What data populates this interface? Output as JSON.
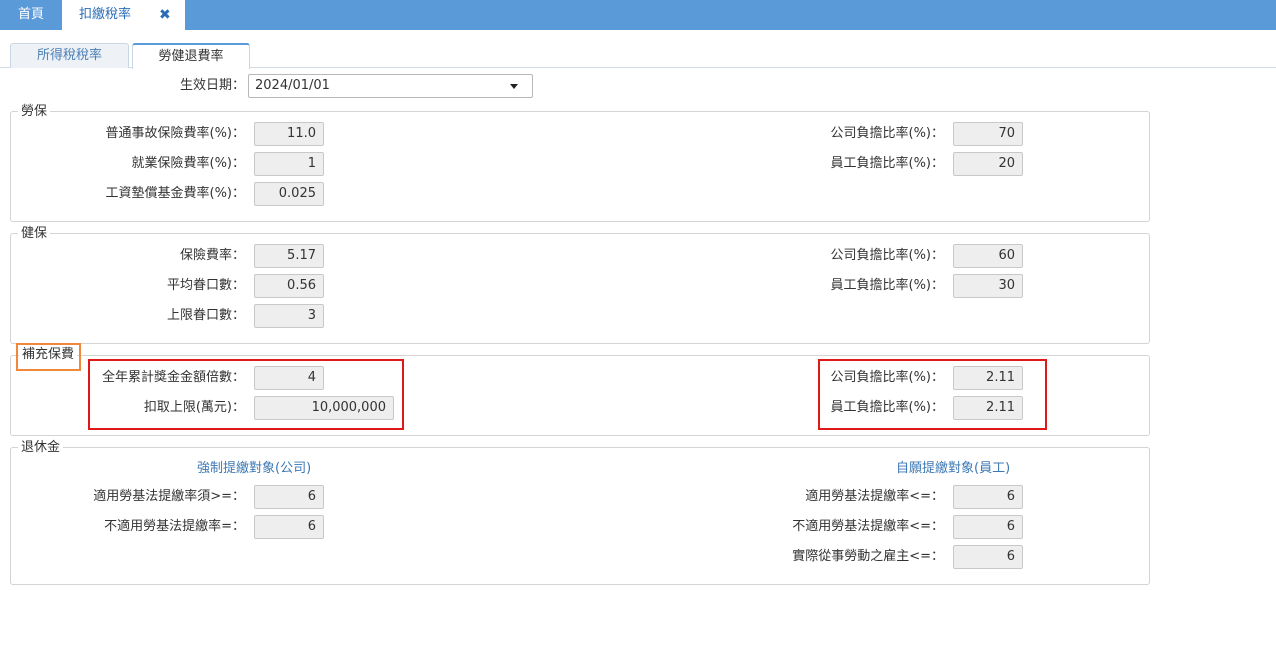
{
  "tabs": {
    "home_label": "首頁",
    "active_label": "扣繳稅率",
    "close_glyph": "✖"
  },
  "subtabs": {
    "income_tax": "所得稅稅率",
    "labor_health": "勞健退費率"
  },
  "effective_date": {
    "label": "生效日期：",
    "value": "2024/01/01"
  },
  "labor_insurance": {
    "legend": "勞保",
    "left": [
      {
        "label": "普通事故保險費率(%)：",
        "value": "11.0"
      },
      {
        "label": "就業保險費率(%)：",
        "value": "1"
      },
      {
        "label": "工資墊償基金費率(%)：",
        "value": "0.025"
      }
    ],
    "right": [
      {
        "label": "公司負擔比率(%)：",
        "value": "70"
      },
      {
        "label": "員工負擔比率(%)：",
        "value": "20"
      }
    ]
  },
  "health_insurance": {
    "legend": "健保",
    "left": [
      {
        "label": "保險費率：",
        "value": "5.17"
      },
      {
        "label": "平均眷口數：",
        "value": "0.56"
      },
      {
        "label": "上限眷口數：",
        "value": "3"
      }
    ],
    "right": [
      {
        "label": "公司負擔比率(%)：",
        "value": "60"
      },
      {
        "label": "員工負擔比率(%)：",
        "value": "30"
      }
    ]
  },
  "supplementary": {
    "legend": "補充保費",
    "left": [
      {
        "label": "全年累計獎金金額倍數：",
        "value": "4"
      },
      {
        "label": "扣取上限(萬元)：",
        "value": "10,000,000"
      }
    ],
    "right": [
      {
        "label": "公司負擔比率(%)：",
        "value": "2.11"
      },
      {
        "label": "員工負擔比率(%)：",
        "value": "2.11"
      }
    ]
  },
  "pension": {
    "legend": "退休金",
    "left_heading": "強制提繳對象(公司)",
    "right_heading": "自願提繳對象(員工)",
    "left": [
      {
        "label": "適用勞基法提繳率須>=：",
        "value": "6"
      },
      {
        "label": "不適用勞基法提繳率=：",
        "value": "6"
      }
    ],
    "right": [
      {
        "label": "適用勞基法提繳率<=：",
        "value": "6"
      },
      {
        "label": "不適用勞基法提繳率<=：",
        "value": "6"
      },
      {
        "label": "實際從事勞動之雇主<=：",
        "value": "6"
      }
    ]
  },
  "colors": {
    "topbar": "#5b9ad9",
    "highlight_red": "#e01818",
    "highlight_orange": "#f08a3a"
  }
}
